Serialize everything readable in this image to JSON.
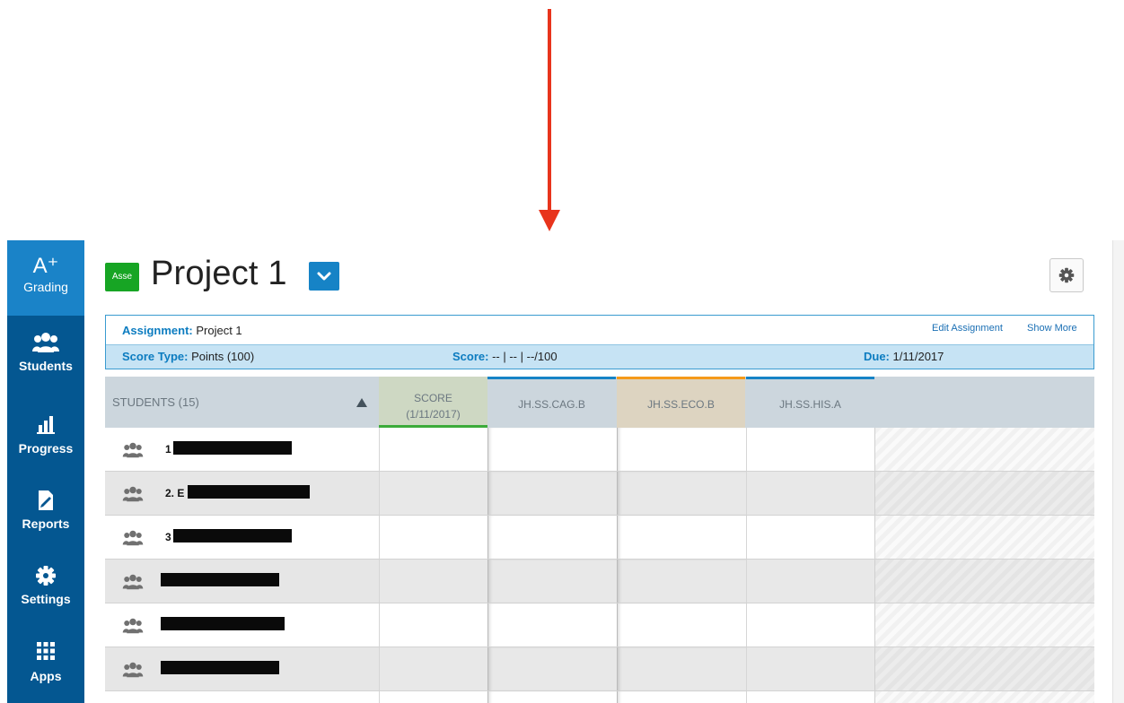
{
  "sidebar": {
    "items": [
      {
        "label": "Grading",
        "icon": "a-plus-icon",
        "icon_text": "A⁺",
        "active": true
      },
      {
        "label": "Students",
        "icon": "students-icon",
        "active": false
      },
      {
        "label": "Progress",
        "icon": "bar-chart-icon",
        "active": false
      },
      {
        "label": "Reports",
        "icon": "report-icon",
        "active": false
      },
      {
        "label": "Settings",
        "icon": "gear-icon",
        "active": false
      },
      {
        "label": "Apps",
        "icon": "apps-grid-icon",
        "active": false
      }
    ]
  },
  "header": {
    "badge": "Asse",
    "title": "Project 1"
  },
  "info": {
    "assignment_label": "Assignment:",
    "assignment_value": "Project 1",
    "edit_link": "Edit Assignment",
    "show_more_link": "Show More",
    "score_type_label": "Score Type:",
    "score_type_value": "Points (100)",
    "score_label": "Score:",
    "score_value": "-- | -- | --/100",
    "due_label": "Due:",
    "due_value": "1/11/2017"
  },
  "table": {
    "students_header": "STUDENTS (15)",
    "score_header_line1": "SCORE",
    "score_header_line2": "(1/11/2017)",
    "standards": [
      "JH.SS.CAG.B",
      "JH.SS.ECO.B",
      "JH.SS.HIS.A"
    ],
    "rows": [
      {
        "num": "1"
      },
      {
        "num": "2. E"
      },
      {
        "num": "3"
      },
      {
        "num": ""
      },
      {
        "num": ""
      },
      {
        "num": ""
      },
      {
        "num": ""
      }
    ]
  },
  "colors": {
    "sidebar": "#045791",
    "sidebar_active": "#1a83c8",
    "badge": "#17a524",
    "accent_blue": "#1683c6",
    "eco_orange": "#f59a1a",
    "score_green": "#3cab3a",
    "arrow": "#e8341c"
  }
}
